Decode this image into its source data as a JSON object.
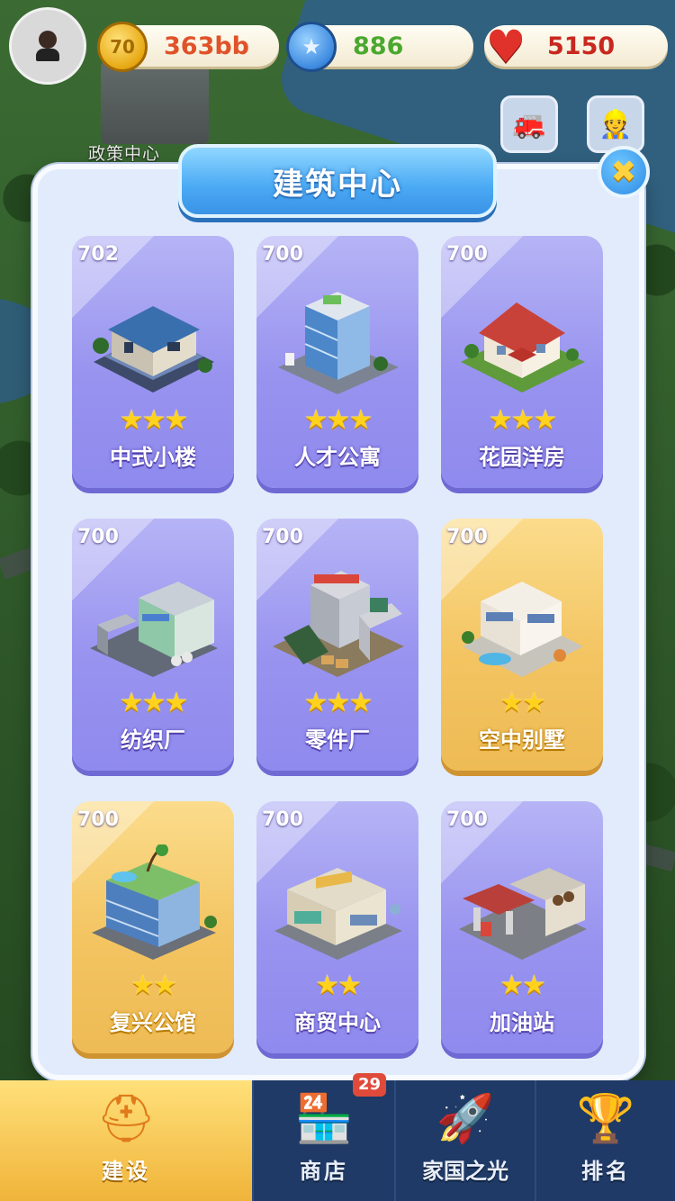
{
  "hud": {
    "coins": "363bb",
    "coin_symbol": "70",
    "stars": "886",
    "star_symbol": "★",
    "hearts": "5150",
    "heart_symbol": "♥"
  },
  "world": {
    "label": "政策中心"
  },
  "dialog": {
    "title": "建筑中心",
    "close_symbol": "✖",
    "cards": [
      {
        "level": "702",
        "stars": "★★★",
        "name": "中式小楼",
        "style": "purple"
      },
      {
        "level": "700",
        "stars": "★★★",
        "name": "人才公寓",
        "style": "purple"
      },
      {
        "level": "700",
        "stars": "★★★",
        "name": "花园洋房",
        "style": "purple"
      },
      {
        "level": "700",
        "stars": "★★★",
        "name": "纺织厂",
        "style": "purple"
      },
      {
        "level": "700",
        "stars": "★★★",
        "name": "零件厂",
        "style": "purple"
      },
      {
        "level": "700",
        "stars": "★★",
        "name": "空中别墅",
        "style": "gold"
      },
      {
        "level": "700",
        "stars": "★★",
        "name": "复兴公馆",
        "style": "gold"
      },
      {
        "level": "700",
        "stars": "★★",
        "name": "商贸中心",
        "style": "purple"
      },
      {
        "level": "700",
        "stars": "★★",
        "name": "加油站",
        "style": "purple"
      }
    ]
  },
  "nav": {
    "items": [
      {
        "label": "建设",
        "icon": "hard-hat-icon",
        "active": true
      },
      {
        "label": "商店",
        "icon": "shop-icon",
        "badge": "29"
      },
      {
        "label": "家国之光",
        "icon": "rocket-icon"
      },
      {
        "label": "排名",
        "icon": "ranking-icon"
      }
    ]
  },
  "colors": {
    "card_purple": "#9893ef",
    "card_gold": "#f3c461",
    "panel": "#e2ebfb",
    "title_blue": "#4aa9f4",
    "nav_bg": "#1f3a66"
  }
}
